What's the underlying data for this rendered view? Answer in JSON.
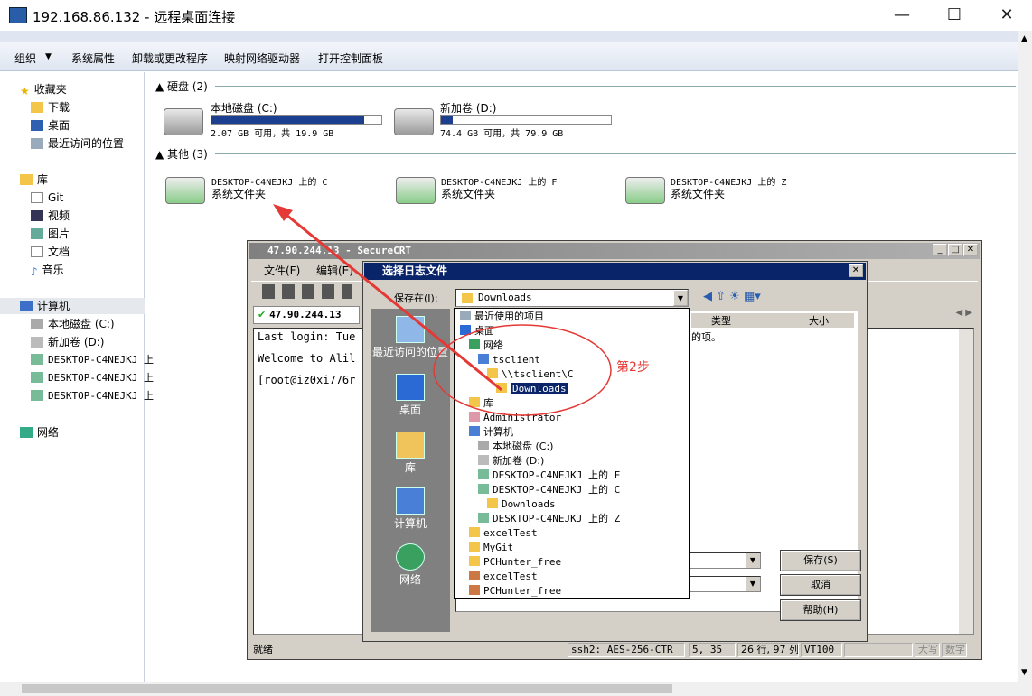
{
  "window": {
    "title": "192.168.86.132 - 远程桌面连接",
    "min": "—",
    "max": "☐",
    "close": "✕"
  },
  "toolbar": {
    "organize": "组织",
    "sys_props": "系统属性",
    "uninstall": "卸载或更改程序",
    "map_drive": "映射网络驱动器",
    "control_panel": "打开控制面板"
  },
  "nav": {
    "favorites": "收藏夹",
    "downloads": "下载",
    "desktop": "桌面",
    "recent": "最近访问的位置",
    "libraries": "库",
    "git": "Git",
    "videos": "视频",
    "pictures": "图片",
    "documents": "文档",
    "music": "音乐",
    "computer": "计算机",
    "local_disk": "本地磁盘 (C:)",
    "new_vol": "新加卷 (D:)",
    "remote1": "DESKTOP-C4NEJKJ 上",
    "remote2": "DESKTOP-C4NEJKJ 上",
    "remote3": "DESKTOP-C4NEJKJ 上",
    "network": "网络"
  },
  "groups": {
    "hdd": "硬盘 (2)",
    "other": "其他 (3)"
  },
  "drives": [
    {
      "name": "本地磁盘 (C:)",
      "info": "2.07 GB 可用，共 19.9 GB",
      "used": 0.9
    },
    {
      "name": "新加卷 (D:)",
      "info": "74.4 GB 可用，共 79.9 GB",
      "used": 0.07
    }
  ],
  "remote": [
    {
      "name": "DESKTOP-C4NEJKJ 上的 C",
      "type": "系统文件夹"
    },
    {
      "name": "DESKTOP-C4NEJKJ 上的 F",
      "type": "系统文件夹"
    },
    {
      "name": "DESKTOP-C4NEJKJ 上的 Z",
      "type": "系统文件夹"
    }
  ],
  "crt": {
    "title": "47.90.244.13 - SecureCRT",
    "menu_file": "文件(F)",
    "menu_edit": "编辑(E)",
    "tab": "47.90.244.13",
    "term_l1": "Last login: Tue",
    "term_l2": "Welcome to Alil",
    "term_l3": "[root@iz0xi776r",
    "ready": "就绪",
    "ssh": "ssh2: AES-256-CTR",
    "pos": "5,  35",
    "size": "26 行, 97 列",
    "vt": "VT100",
    "caps": "大写",
    "num": "数字"
  },
  "dialog": {
    "title": "选择日志文件",
    "save_in": "保存在(I):",
    "folder": "Downloads",
    "col_type": "类型",
    "col_size": "大小",
    "desc_frag": "的项。",
    "save": "保存(S)",
    "cancel": "取消",
    "help": "帮助(H)",
    "close": "✕"
  },
  "places": {
    "recent": "最近访问的位置",
    "desktop": "桌面",
    "libraries": "库",
    "computer": "计算机",
    "network": "网络"
  },
  "dropdown": [
    "最近使用的项目",
    "桌面",
    "网络",
    "tsclient",
    "\\\\tsclient\\C",
    "Downloads",
    "库",
    "Administrator",
    "计算机",
    "本地磁盘 (C:)",
    "新加卷 (D:)",
    "DESKTOP-C4NEJKJ 上的 F",
    "DESKTOP-C4NEJKJ 上的 C",
    "Downloads",
    "DESKTOP-C4NEJKJ 上的 Z",
    "excelTest",
    "MyGit",
    "PCHunter_free",
    "excelTest",
    "PCHunter_free"
  ],
  "annotation": {
    "step": "第2步",
    "color": "#e53935"
  }
}
